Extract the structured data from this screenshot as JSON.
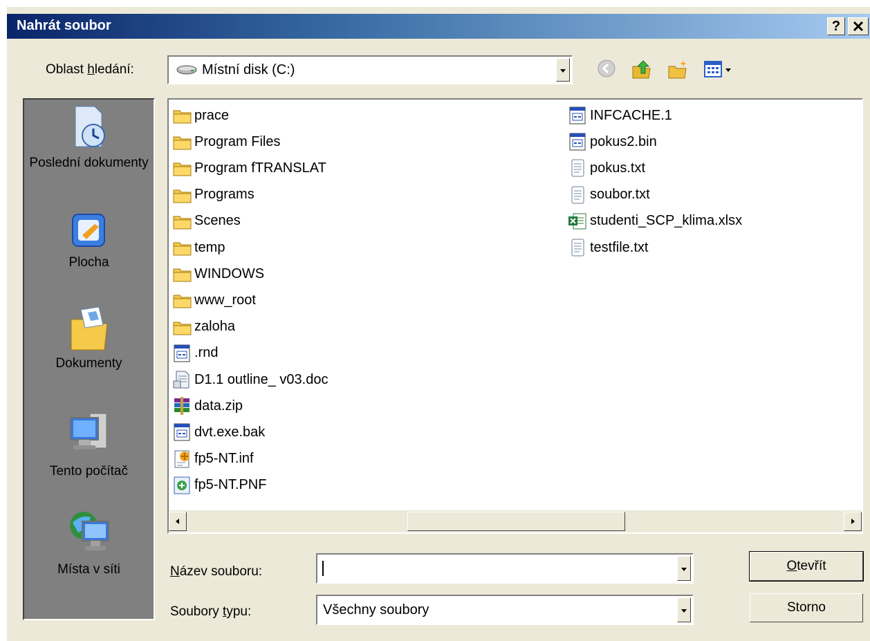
{
  "window": {
    "title": "Nahrát soubor",
    "help_label": "?",
    "close_label": "✕"
  },
  "lookin": {
    "label_before": "Oblast ",
    "label_accel": "h",
    "label_after": "ledání:",
    "value": "Místní disk (C:)"
  },
  "toolbar": {
    "back_icon": "back-arrow-icon",
    "up_icon": "up-folder-icon",
    "new_folder_icon": "new-folder-icon",
    "view_icon": "view-menu-icon"
  },
  "places": [
    {
      "label": "Poslední dokumenty",
      "icon": "recent-documents-icon"
    },
    {
      "label": "Plocha",
      "icon": "desktop-icon"
    },
    {
      "label": "Dokumenty",
      "icon": "my-documents-icon"
    },
    {
      "label": "Tento počítač",
      "icon": "my-computer-icon"
    },
    {
      "label": "Místa v síti",
      "icon": "network-places-icon"
    }
  ],
  "files_col1": [
    {
      "name": "prace",
      "type": "folder"
    },
    {
      "name": "Program Files",
      "type": "folder"
    },
    {
      "name": "Program fTRANSLAT",
      "type": "folder"
    },
    {
      "name": "Programs",
      "type": "folder"
    },
    {
      "name": "Scenes",
      "type": "folder"
    },
    {
      "name": "temp",
      "type": "folder"
    },
    {
      "name": "WINDOWS",
      "type": "folder"
    },
    {
      "name": "www_root",
      "type": "folder"
    },
    {
      "name": "zaloha",
      "type": "folder"
    },
    {
      "name": ".rnd",
      "type": "generic"
    },
    {
      "name": "D1.1 outline_ v03.doc",
      "type": "doc"
    },
    {
      "name": "data.zip",
      "type": "zip"
    },
    {
      "name": "dvt.exe.bak",
      "type": "generic"
    },
    {
      "name": "fp5-NT.inf",
      "type": "inf"
    },
    {
      "name": "fp5-NT.PNF",
      "type": "pnf"
    }
  ],
  "files_col2": [
    {
      "name": "INFCACHE.1",
      "type": "generic"
    },
    {
      "name": "pokus2.bin",
      "type": "generic"
    },
    {
      "name": "pokus.txt",
      "type": "txt"
    },
    {
      "name": "soubor.txt",
      "type": "txt"
    },
    {
      "name": "studenti_SCP_klima.xlsx",
      "type": "xlsx"
    },
    {
      "name": "testfile.txt",
      "type": "txt"
    }
  ],
  "filename": {
    "label_accel": "N",
    "label_after": "ázev souboru:",
    "value": ""
  },
  "filetype": {
    "label_before": "Soubory ",
    "label_accel": "t",
    "label_after": "ypu:",
    "value": "Všechny soubory"
  },
  "buttons": {
    "open_accel": "O",
    "open_after": "tevřít",
    "cancel": "Storno"
  }
}
